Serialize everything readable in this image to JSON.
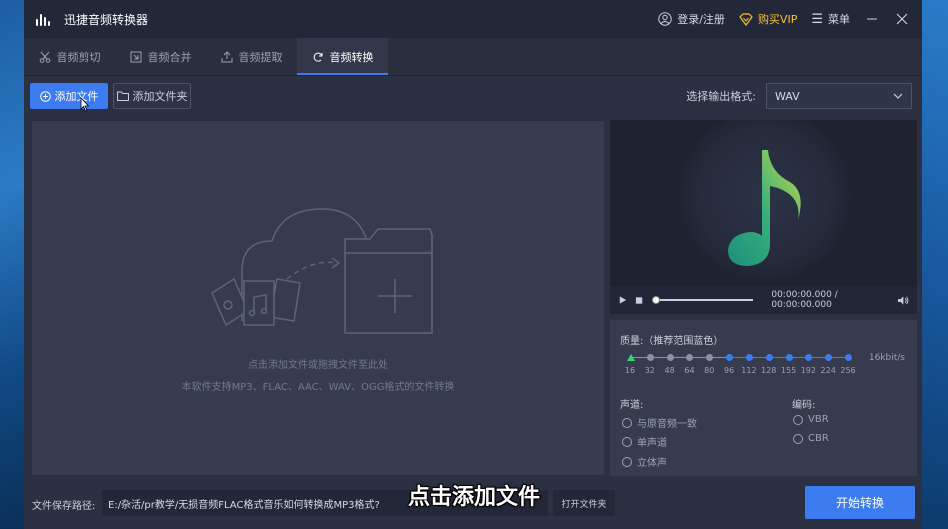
{
  "app": {
    "title": "迅捷音频转换器"
  },
  "titlebar": {
    "login": "登录/注册",
    "vip": "购买VIP",
    "menu": "菜单"
  },
  "tabs": [
    {
      "label": "音频剪切",
      "icon": "scissors-icon"
    },
    {
      "label": "音频合并",
      "icon": "merge-icon"
    },
    {
      "label": "音频提取",
      "icon": "extract-icon"
    },
    {
      "label": "音频转换",
      "icon": "convert-icon",
      "active": true
    }
  ],
  "toolbar": {
    "add_file": "添加文件",
    "add_folder": "添加文件夹",
    "format_label": "选择输出格式:",
    "format_value": "WAV"
  },
  "dropzone": {
    "hint": "点击添加文件或拖拽文件至此处",
    "support": "本软件支持MP3、FLAC、AAC、WAV、OGG格式的文件转换"
  },
  "player": {
    "time": "00:00:00.000 / 00:00:00.000"
  },
  "settings": {
    "quality_label": "质量:（推荐范围蓝色）",
    "bitrates": [
      "16",
      "32",
      "48",
      "64",
      "80",
      "96",
      "112",
      "128",
      "155",
      "192",
      "224",
      "256"
    ],
    "bitrate_readout": "16kbit/s",
    "channel_label": "声道:",
    "channels": [
      "与原音频一致",
      "单声道",
      "立体声"
    ],
    "encoding_label": "编码:",
    "encodings": [
      "VBR",
      "CBR"
    ]
  },
  "bottom": {
    "path_label": "文件保存路径:",
    "path_value": "E:/杂活/pr教学/无损音频FLAC格式音乐如何转换成MP3格式?",
    "open_folder": "打开文件夹",
    "start": "开始转换"
  },
  "overlay_caption": "点击添加文件",
  "colors": {
    "accent": "#3d7cf0",
    "vip": "#f5c231",
    "recommended": "#3d7cf0",
    "selected": "#3bd17b"
  }
}
